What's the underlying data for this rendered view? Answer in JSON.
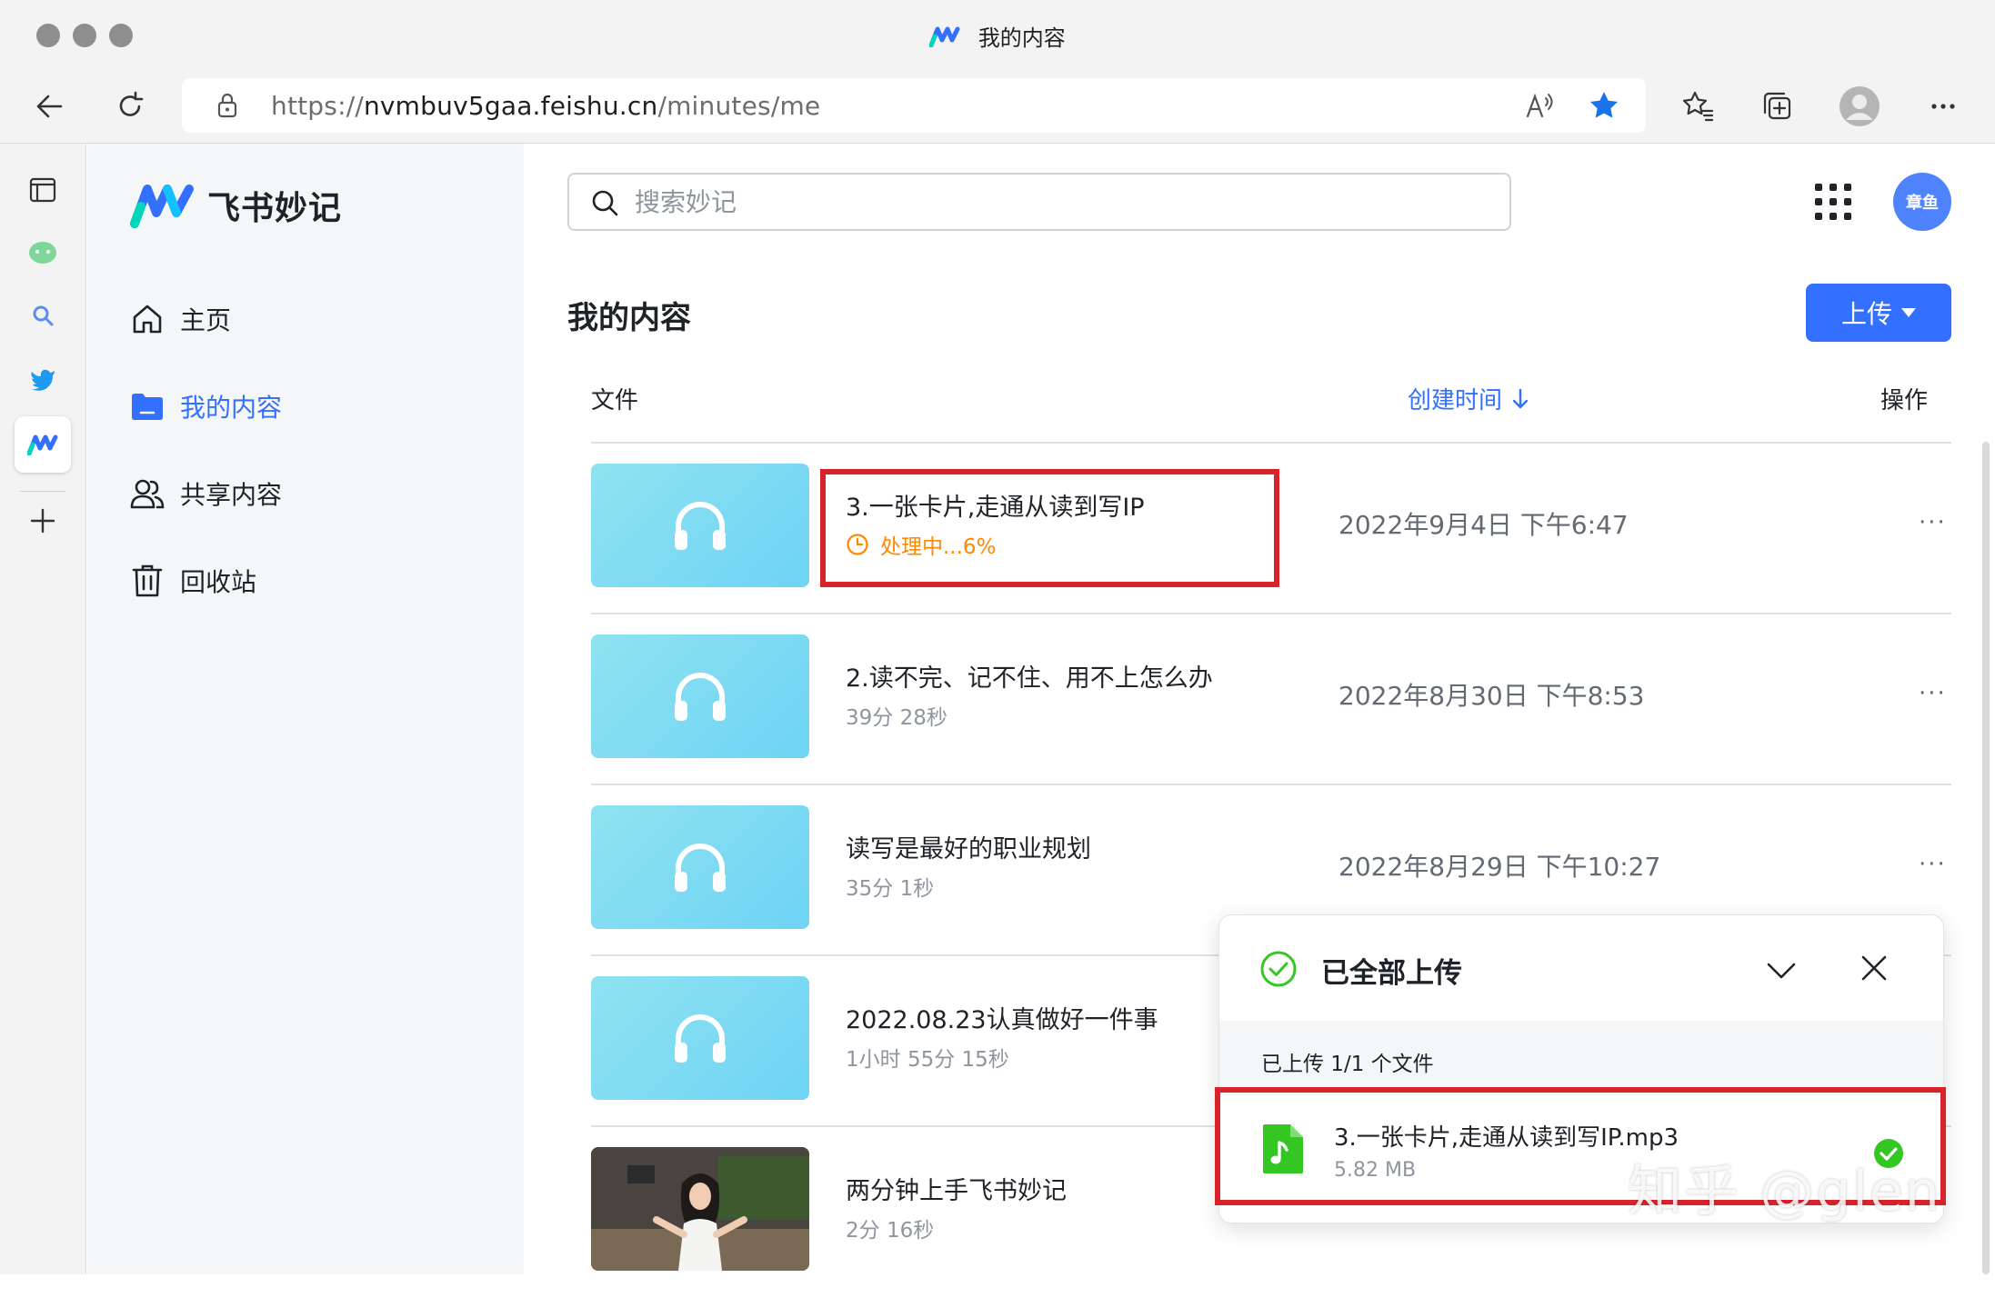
{
  "browser": {
    "tab_title": "我的内容",
    "url_prefix": "https://",
    "url_host": "nvmbuv5gaa.feishu.cn",
    "url_path": "/minutes/me",
    "read_aloud_icon": "read-aloud-icon",
    "favorite_icon": "star-filled-icon",
    "accent_color": "#1a73e8"
  },
  "app": {
    "brand_name": "飞书妙记",
    "brand_colors": [
      "#3370ff",
      "#14c0ff",
      "#00d6b9"
    ],
    "menu": [
      {
        "label": "主页",
        "icon": "home-icon",
        "active": false
      },
      {
        "label": "我的内容",
        "icon": "folder-icon",
        "active": true
      },
      {
        "label": "共享内容",
        "icon": "people-icon",
        "active": false
      },
      {
        "label": "回收站",
        "icon": "trash-icon",
        "active": false
      }
    ],
    "search": {
      "placeholder": "搜索妙记"
    },
    "avatar_text": "章鱼",
    "primary_color": "#3370ff"
  },
  "main": {
    "title": "我的内容",
    "upload_label": "上传",
    "columns": {
      "file": "文件",
      "created": "创建时间",
      "action": "操作"
    },
    "rows": [
      {
        "title": "3.一张卡片,走通从读到写IP",
        "sub": "处理中...6%",
        "date": "2022年9月4日 下午6:47",
        "more": "···",
        "status": "processing",
        "progress": 0.06
      },
      {
        "title": "2.读不完、记不住、用不上怎么办",
        "sub": "39分 28秒",
        "date": "2022年8月30日 下午8:53",
        "more": "···"
      },
      {
        "title": "读写是最好的职业规划",
        "sub": "35分 1秒",
        "date": "2022年8月29日 下午10:27",
        "more": "···"
      },
      {
        "title": "2022.08.23认真做好一件事",
        "sub": "1小时 55分 15秒",
        "date": "",
        "more": ""
      },
      {
        "title": "两分钟上手飞书妙记",
        "sub": "2分 16秒",
        "date": "",
        "more": ""
      }
    ]
  },
  "upload_popup": {
    "title": "已全部上传",
    "count_text": "已上传 1/1 个文件",
    "file_name": "3.一张卡片,走通从读到写IP.mp3",
    "file_size": "5.82 MB",
    "success_color": "#34c724",
    "file_icon_color": "#34c724"
  },
  "watermark": "知乎 @glen"
}
